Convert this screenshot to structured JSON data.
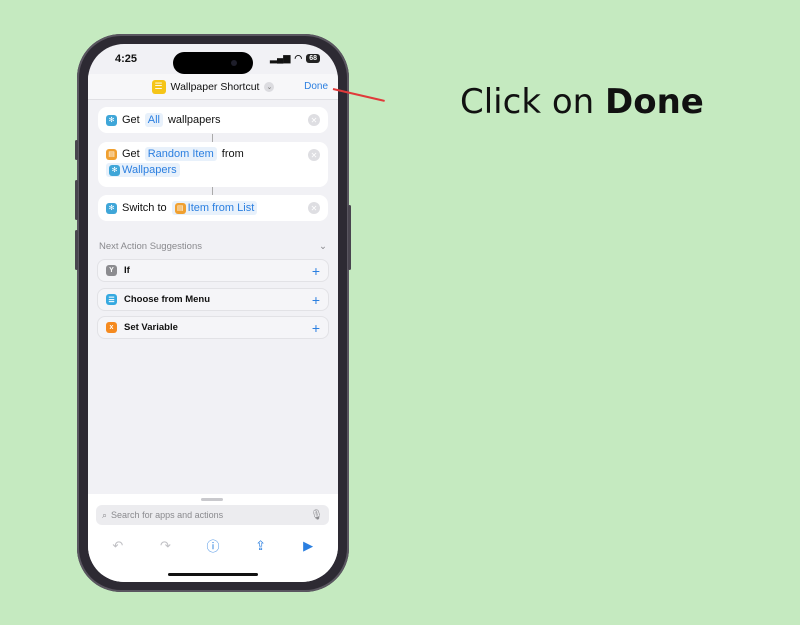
{
  "status_bar": {
    "time": "4:25",
    "battery": "68"
  },
  "nav": {
    "title": "Wallpaper Shortcut",
    "done_label": "Done"
  },
  "actions": [
    {
      "verb": "Get",
      "token": "All",
      "suffix": "wallpapers"
    },
    {
      "verb": "Get",
      "token": "Random Item",
      "suffix": "from",
      "source_token": "Wallpapers"
    },
    {
      "verb": "Switch to",
      "token": "Item from List"
    }
  ],
  "suggestions": {
    "header": "Next Action Suggestions",
    "items": [
      {
        "label": "If",
        "icon": "if-branch-icon"
      },
      {
        "label": "Choose from Menu",
        "icon": "menu-icon"
      },
      {
        "label": "Set Variable",
        "icon": "variable-icon"
      }
    ]
  },
  "search": {
    "placeholder": "Search for apps and actions"
  },
  "instruction": {
    "prefix": "Click on ",
    "emphasis": "Done"
  },
  "colors": {
    "accent": "#2b7fe0",
    "background": "#c5eac0",
    "pointer": "#e03a3a"
  }
}
